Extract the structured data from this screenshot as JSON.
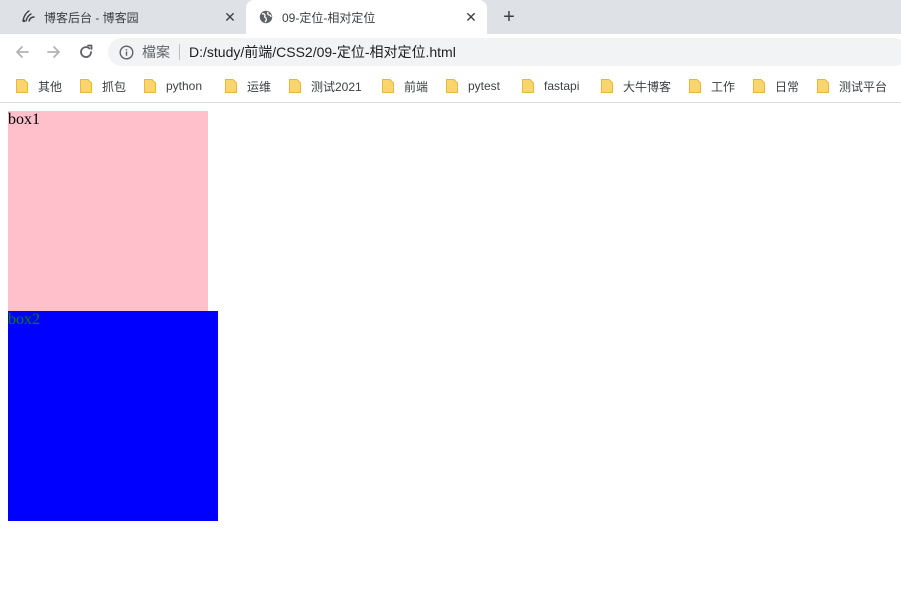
{
  "tabs": [
    {
      "title": "博客后台 - 博客园",
      "close_label": "✕",
      "favicon": "cnblogs-icon",
      "active": false
    },
    {
      "title": "09-定位-相对定位",
      "close_label": "✕",
      "favicon": "globe-icon",
      "active": true
    }
  ],
  "new_tab_label": "+",
  "toolbar": {
    "back_icon": "back-arrow-icon",
    "forward_icon": "forward-arrow-icon",
    "reload_icon": "reload-icon"
  },
  "omnibox": {
    "scheme_label": "檔案",
    "url": "D:/study/前端/CSS2/09-定位-相对定位.html"
  },
  "bookmarks": [
    {
      "label": "其他"
    },
    {
      "label": "抓包"
    },
    {
      "label": "python"
    },
    {
      "label": "运维"
    },
    {
      "label": "测试2021"
    },
    {
      "label": "前端"
    },
    {
      "label": "pytest"
    },
    {
      "label": "fastapi"
    },
    {
      "label": "大牛博客"
    },
    {
      "label": "工作"
    },
    {
      "label": "日常"
    },
    {
      "label": "测试平台"
    }
  ],
  "content": {
    "box1": {
      "text": "box1",
      "background": "#ffc0cb",
      "color": "#000000"
    },
    "box2": {
      "text": "box2",
      "background": "#0000ff",
      "color": "#008000"
    }
  },
  "colors": {
    "tabstrip": "#dee1e6",
    "omnibox": "#f1f3f4",
    "folder": "#f9d56e"
  }
}
